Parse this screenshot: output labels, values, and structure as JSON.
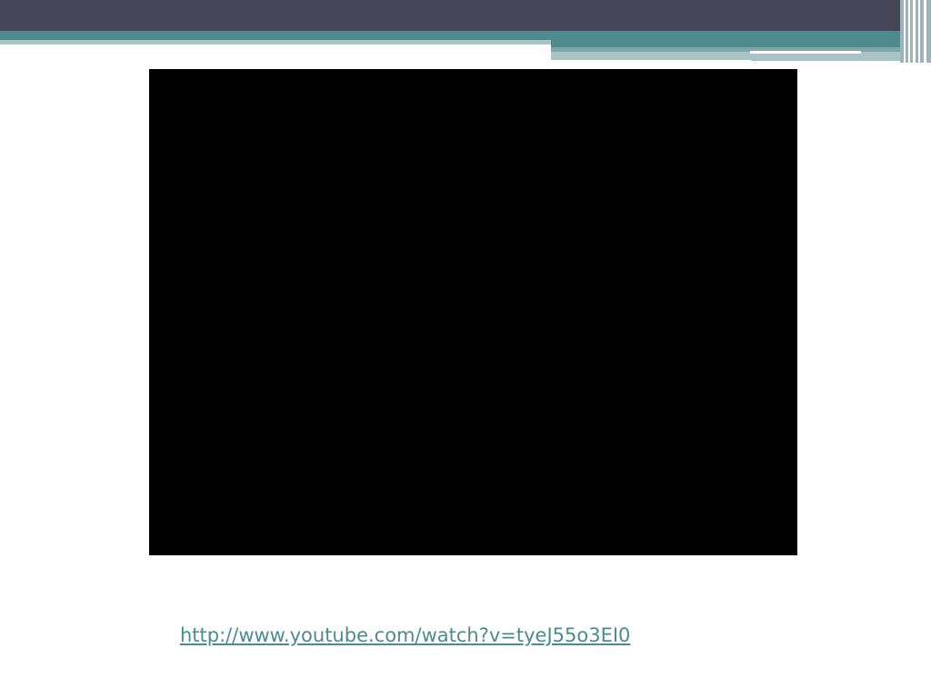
{
  "slide": {
    "video_link": "http://www.youtube.com/watch?v=tyeJ55o3EI0"
  },
  "colors": {
    "header_dark": "#454759",
    "accent_teal": "#4f8a8e",
    "accent_light": "#a9c3c6",
    "video_background": "#000000",
    "link_color": "#4f8a8e"
  }
}
